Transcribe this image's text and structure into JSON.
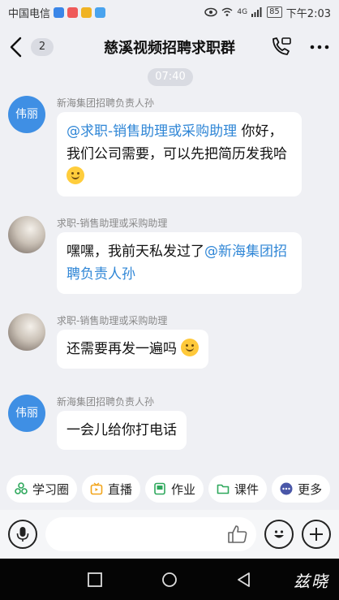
{
  "status_bar": {
    "carrier": "中国电信",
    "network": "4G",
    "battery": "85",
    "time": "下午2:03"
  },
  "header": {
    "unread_count": "2",
    "title": "慈溪视频招聘求职群"
  },
  "timestamp": "07:40",
  "messages": [
    {
      "avatar_text": "伟丽",
      "sender": "新海集团招聘负责人孙",
      "mention": "@求职-销售助理或采购助理",
      "text": " 你好，我们公司需要，可以先把简历发我哈"
    },
    {
      "sender": "求职-销售助理或采购助理",
      "text": "嘿嘿，我前天私发过了",
      "mention": "@新海集团招聘负责人孙"
    },
    {
      "sender": "求职-销售助理或采购助理",
      "text": "还需要再发一遍吗"
    },
    {
      "avatar_text": "伟丽",
      "sender": "新海集团招聘负责人孙",
      "text": "一会儿给你打电话"
    }
  ],
  "quick_actions": [
    {
      "label": "学习圈",
      "icon": "study-circle-icon",
      "color": "#2ea85c"
    },
    {
      "label": "直播",
      "icon": "live-icon",
      "color": "#f2a41a"
    },
    {
      "label": "作业",
      "icon": "homework-icon",
      "color": "#2ea85c"
    },
    {
      "label": "课件",
      "icon": "courseware-icon",
      "color": "#2ea85c"
    },
    {
      "label": "更多",
      "icon": "more-dots-icon",
      "color": "#4a57a8"
    }
  ],
  "input": {
    "placeholder": ""
  },
  "watermark": "兹晓",
  "colors": {
    "mention": "#2f86d6",
    "avatar_blue": "#3f8fe4",
    "background": "#eff0f4"
  }
}
